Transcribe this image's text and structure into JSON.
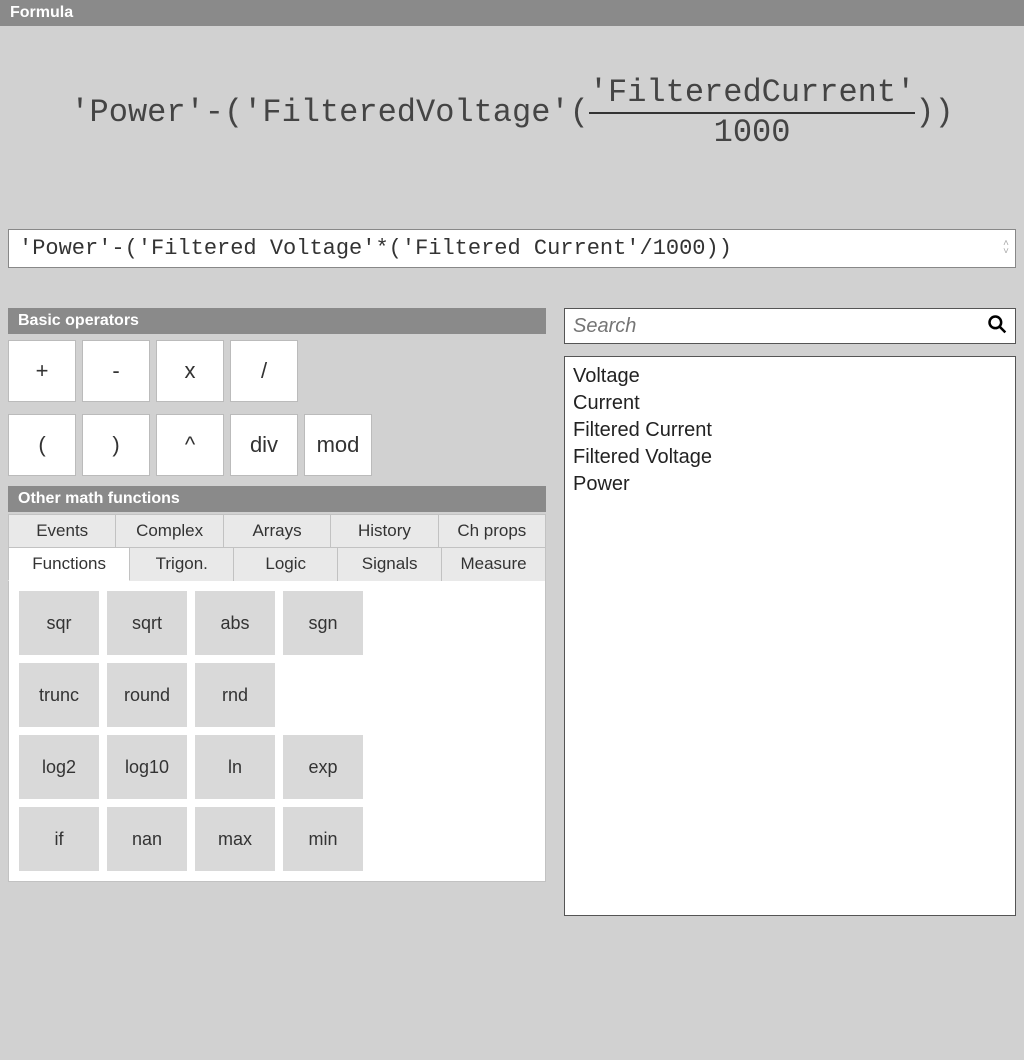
{
  "header": {
    "title": "Formula"
  },
  "formula": {
    "display": {
      "pre": "'Power'-('FilteredVoltage'(",
      "num": "'FilteredCurrent'",
      "den": "1000",
      "post": "))"
    },
    "input_value": "'Power'-('Filtered Voltage'*('Filtered Current'/1000))"
  },
  "operators": {
    "title": "Basic operators",
    "row1": {
      "add": "+",
      "sub": "-",
      "mul": "x",
      "div": "/"
    },
    "row2": {
      "lparen": "(",
      "rparen": ")",
      "pow": "^",
      "idiv": "div",
      "mod": "mod"
    }
  },
  "functions": {
    "title": "Other math functions",
    "tabs_row1": {
      "events": "Events",
      "complex": "Complex",
      "arrays": "Arrays",
      "history": "History",
      "chprops": "Ch props"
    },
    "tabs_row2": {
      "functions": "Functions",
      "trigon": "Trigon.",
      "logic": "Logic",
      "signals": "Signals",
      "measure": "Measure"
    },
    "buttons": {
      "sqr": "sqr",
      "sqrt": "sqrt",
      "abs": "abs",
      "sgn": "sgn",
      "trunc": "trunc",
      "round": "round",
      "rnd": "rnd",
      "log2": "log2",
      "log10": "log10",
      "ln": "ln",
      "exp": "exp",
      "if": "if",
      "nan": "nan",
      "max": "max",
      "min": "min"
    }
  },
  "search": {
    "placeholder": "Search"
  },
  "channels": {
    "items": [
      "Voltage",
      "Current",
      "Filtered Current",
      "Filtered Voltage",
      "Power"
    ]
  }
}
